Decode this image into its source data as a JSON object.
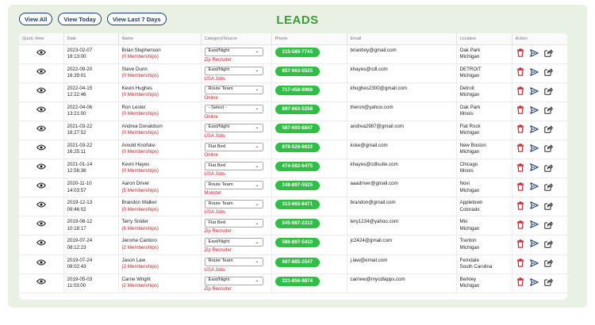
{
  "filters": {
    "all": "View All",
    "today": "View Today",
    "last7": "View Last 7 Days"
  },
  "title": "LEADS",
  "columns": [
    "Quick View",
    "Date",
    "Name",
    "Category/Source",
    "Phone",
    "Email",
    "Location",
    "Action"
  ],
  "rows": [
    {
      "date": "2023-02-07",
      "time": "18:13:00",
      "name": "Brian Stephenson",
      "memberships": "(0 Memberships)",
      "category": "East/Night",
      "source": "Zip Recruiter",
      "phone": "215-589-7745",
      "email": "brianboy@gmail.com",
      "city": "Oak Park",
      "state": "Michigan"
    },
    {
      "date": "2022-09-20",
      "time": "16:39:01",
      "name": "Steve Dunn",
      "memberships": "(0 Memberships)",
      "category": "East/Night",
      "source": "USA Jobs",
      "phone": "857-963-5525",
      "email": "khayes@cdl.com",
      "city": "DETROIT",
      "state": "Michigan"
    },
    {
      "date": "2022-04-15",
      "time": "12:22:46",
      "name": "Kevin Hughes",
      "memberships": "(0 Memberships)",
      "category": "Route Team",
      "source": "Online",
      "phone": "717-458-9969",
      "email": "khughes2300@gmail.com",
      "city": "Detroit",
      "state": "Michigan"
    },
    {
      "date": "2022-04-06",
      "time": "13:21:00",
      "name": "Ron Lester",
      "memberships": "(0 Memberships)",
      "category": "- Select -",
      "source": "Online",
      "phone": "897-663-5258",
      "email": "theron@yahoo.com",
      "city": "Oak Park",
      "state": "Illinois"
    },
    {
      "date": "2021-03-22",
      "time": "16:27:52",
      "name": "Andrea Donaldson",
      "memberships": "(0 Memberships)",
      "category": "East/Night",
      "source": "USA Jobs",
      "phone": "587-693-8847",
      "email": "andrea2987@gmail.com",
      "city": "Flat Rock",
      "state": "Michigan"
    },
    {
      "date": "2021-03-22",
      "time": "16:25:11",
      "name": "Arnold Knofske",
      "memberships": "(0 Memberships)",
      "category": "Flat Bed",
      "source": "Online",
      "phone": "878-528-6632",
      "email": "kske@gmail.com",
      "city": "New Boston",
      "state": "Michigan"
    },
    {
      "date": "2021-01-14",
      "time": "12:56:36",
      "name": "Kevin Hayes",
      "memberships": "(0 Memberships)",
      "category": "Flat Bed",
      "source": "USA Jobs",
      "phone": "474-582-6475",
      "email": "khayes@cdlsuite.com",
      "city": "Chicago",
      "state": "Illinois"
    },
    {
      "date": "2020-11-10",
      "time": "14:03:57",
      "name": "Aaron Driver",
      "memberships": "(5 Memberships)",
      "category": "Route Team",
      "source": "Monster",
      "phone": "248-897-5525",
      "email": "aaadriver@gmail.com",
      "city": "Novi",
      "state": "Michigan"
    },
    {
      "date": "2019-12-13",
      "time": "09:46:02",
      "name": "Brandon Walker",
      "memberships": "(0 Memberships)",
      "category": "Route Team",
      "source": "USA Jobs",
      "phone": "313-665-8471",
      "email": "brandon@gmail.com",
      "city": "Appletown",
      "state": "Colorado"
    },
    {
      "date": "2019-08-12",
      "time": "10:18:17",
      "name": "Terry Snider",
      "memberships": "(6 Memberships)",
      "category": "Flat Bed",
      "source": "Zip Recruiter",
      "phone": "545-987-2212",
      "email": "tery1234@yahoo.com",
      "city": "Mio",
      "state": "Michigan"
    },
    {
      "date": "2019-07-24",
      "time": "08:12:23",
      "name": "Jerome Cantoro",
      "memberships": "(2 Memberships)",
      "category": "East/Night",
      "source": "Zip Recruiter",
      "phone": "586-897-5410",
      "email": "jc2424@gmail.com",
      "city": "Trenton",
      "state": "Michigan"
    },
    {
      "date": "2019-07-24",
      "time": "08:02:43",
      "name": "Jason Law",
      "memberships": "(3 Memberships)",
      "category": "Route Team",
      "source": "USA Jobs",
      "phone": "687-885-2547",
      "email": "j.law@email.com",
      "city": "Ferndale",
      "state": "South Carolina"
    },
    {
      "date": "2019-05-03",
      "time": "11:03:00",
      "name": "Carrie Wright",
      "memberships": "(2 Memberships)",
      "category": "East/Night",
      "source": "Zip Recruiter",
      "phone": "221-856-9874",
      "email": "carriew@mycdlapps.com",
      "city": "Berkley",
      "state": "Michigan"
    }
  ],
  "icons": {
    "quick_view": "eye-icon",
    "delete": "trash-icon",
    "send": "send-icon",
    "export": "export-icon",
    "delete_color": "#c6252b",
    "send_color": "#1f3c6e"
  }
}
